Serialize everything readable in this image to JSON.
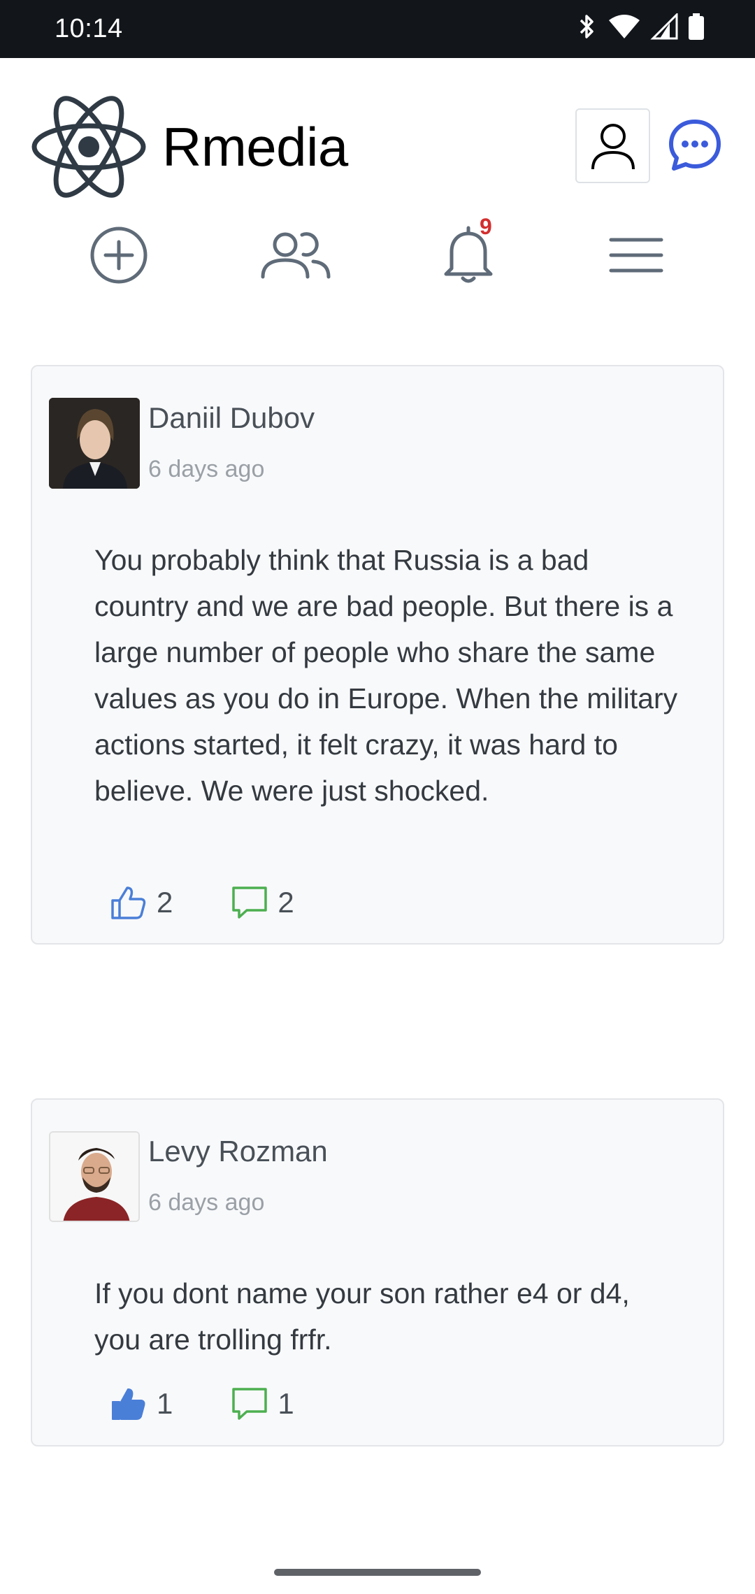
{
  "status_bar": {
    "time": "10:14"
  },
  "app": {
    "name": "Rmedia"
  },
  "nav": {
    "notifications_count": "9"
  },
  "posts": [
    {
      "author": "Daniil Dubov",
      "time": "6 days ago",
      "body": "You probably think that Russia is a bad country and we are bad people. But there is a large number of people who share the same values as you do in Europe. When the military actions started, it felt crazy, it was hard to believe. We were just shocked.",
      "likes": "2",
      "comments": "2",
      "liked": false
    },
    {
      "author": "Levy Rozman",
      "time": "6 days ago",
      "body": "If you dont name your son rather e4 or d4, you are trolling frfr.",
      "likes": "1",
      "comments": "1",
      "liked": true
    }
  ],
  "colors": {
    "accent_blue": "#3b5bdb",
    "like_blue": "#4a7fd8",
    "comment_green": "#4caf50",
    "badge_red": "#d32f2f",
    "icon_gray": "#5f6b78"
  }
}
